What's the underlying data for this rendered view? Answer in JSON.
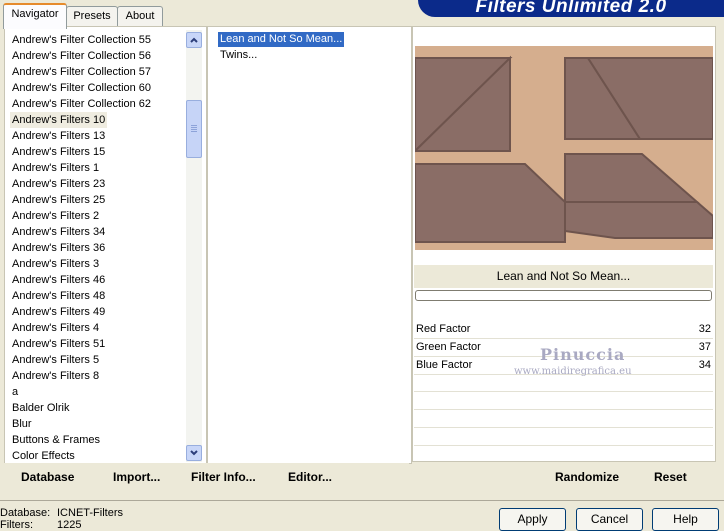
{
  "tabs": [
    {
      "label": "Navigator",
      "active": true
    },
    {
      "label": "Presets",
      "active": false
    },
    {
      "label": "About",
      "active": false
    }
  ],
  "banner": "Filters Unlimited 2.0",
  "categories": {
    "items": [
      "Andrew's Filter Collection 55",
      "Andrew's Filter Collection 56",
      "Andrew's Filter Collection 57",
      "Andrew's Filter Collection 60",
      "Andrew's Filter Collection 62",
      "Andrew's Filters 10",
      "Andrew's Filters 13",
      "Andrew's Filters 15",
      "Andrew's Filters 1",
      "Andrew's Filters 23",
      "Andrew's Filters 25",
      "Andrew's Filters 2",
      "Andrew's Filters 34",
      "Andrew's Filters 36",
      "Andrew's Filters 3",
      "Andrew's Filters 46",
      "Andrew's Filters 48",
      "Andrew's Filters 49",
      "Andrew's Filters 4",
      "Andrew's Filters 51",
      "Andrew's Filters 5",
      "Andrew's Filters 8",
      "a",
      "Balder Olrik",
      "Blur",
      "Buttons & Frames",
      "Color Effects"
    ],
    "selected": "Andrew's Filters 10"
  },
  "filters": {
    "items": [
      "Lean and Not So Mean...",
      "Twins..."
    ],
    "selected": "Lean and Not So Mean..."
  },
  "preview": {
    "filter_name": "Lean and Not So Mean...",
    "colors": {
      "background": "#d5ae8e",
      "shape": "#8a6d66"
    }
  },
  "params": [
    {
      "label": "Red Factor",
      "value": "32"
    },
    {
      "label": "Green Factor",
      "value": "37"
    },
    {
      "label": "Blue Factor",
      "value": "34"
    }
  ],
  "watermark": {
    "name": "Pinuccia",
    "url": "www.maidiregrafica.eu"
  },
  "bottom_links": {
    "database": "Database",
    "import": "Import...",
    "filter_info": "Filter Info...",
    "editor": "Editor...",
    "randomize": "Randomize",
    "reset": "Reset"
  },
  "status": {
    "database_label": "Database:",
    "database_value": "ICNET-Filters",
    "filters_label": "Filters:",
    "filters_value": "1225"
  },
  "buttons": {
    "apply": "Apply",
    "cancel": "Cancel",
    "help": "Help"
  }
}
